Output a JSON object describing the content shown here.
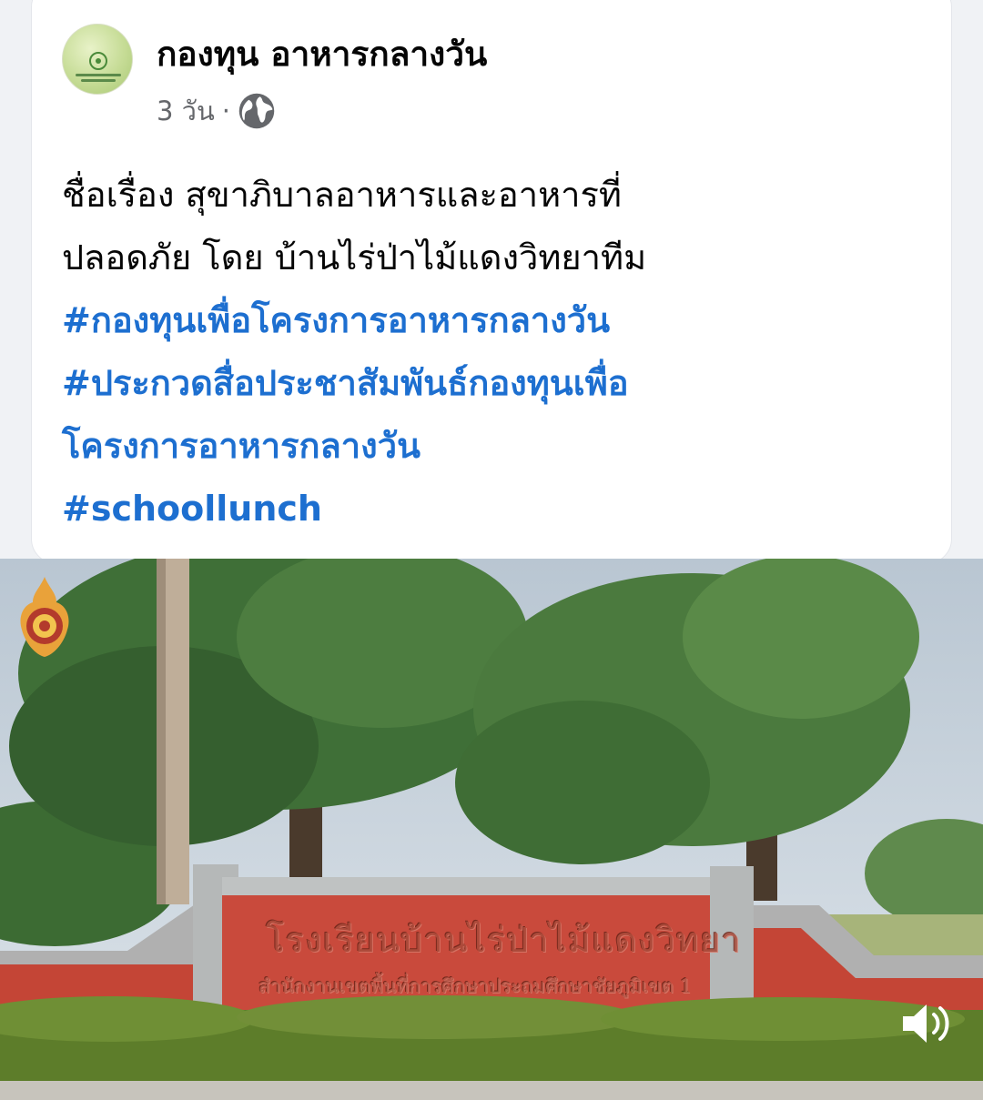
{
  "post": {
    "page_name": "กองทุน อาหารกลางวัน",
    "time": "3 วัน",
    "separator": "·",
    "audience_icon": "globe-icon",
    "text_lines": [
      "ชื่อเรื่อง สุขาภิบาลอาหารและอาหารที่",
      "ปลอดภัย  โดย บ้านไร่ป่าไม้แดงวิทยาทีม"
    ],
    "hashtags": [
      "#กองทุนเพื่อโครงการอาหารกลางวัน",
      "#ประกวดสื่อประชาสัมพันธ์กองทุนเพื่อ",
      "โครงการอาหารกลางวัน",
      "#schoollunch"
    ]
  },
  "video": {
    "sign_title": "โรงเรียนบ้านไร่ป่าไม้แดงวิทยา",
    "sign_subtitle": "สำนักงานเขตพื้นที่การศึกษาประถมศึกษาชัยภูมิเขต 1",
    "sound_icon": "speaker-icon",
    "emblem_icon": "emblem-icon"
  },
  "colors": {
    "hashtag": "#1d6fd0",
    "text": "#050505",
    "meta": "#65676b",
    "wall": "#c9493b"
  }
}
